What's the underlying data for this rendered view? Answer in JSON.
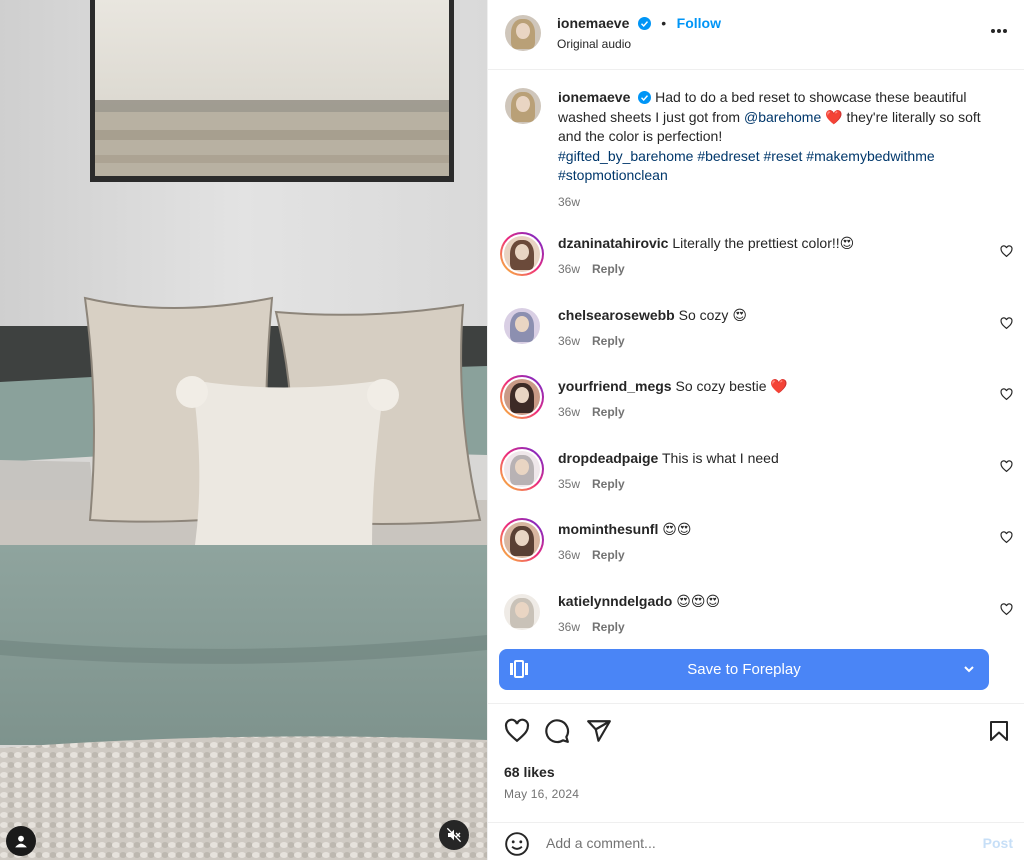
{
  "post": {
    "username": "ionemaeve",
    "separator": "•",
    "follow_label": "Follow",
    "audio_label": "Original audio",
    "more_icon": "more-horizontal-icon"
  },
  "caption": {
    "username": "ionemaeve",
    "text_1": "Had to do a bed reset to showcase these beautiful washed sheets I just got from ",
    "mention": "@barehome",
    "emoji": "❤️",
    "text_2": " they're literally so soft and the color is perfection!",
    "hashtags": "#gifted_by_barehome #bedreset #reset #makemybedwithme #stopmotionclean",
    "time": "36w"
  },
  "comments": [
    {
      "username": "dzaninatahirovic",
      "text": "Literally the prettiest color!!😍",
      "time": "36w",
      "reply_label": "Reply"
    },
    {
      "username": "chelsearosewebb",
      "text": "So cozy 😍",
      "time": "36w",
      "reply_label": "Reply"
    },
    {
      "username": "yourfriend_megs",
      "text": "So cozy bestie ❤️",
      "time": "36w",
      "reply_label": "Reply"
    },
    {
      "username": "dropdeadpaige",
      "text": "This is what I need",
      "time": "35w",
      "reply_label": "Reply"
    },
    {
      "username": "mominthesunfl",
      "text": "😍😍",
      "time": "36w",
      "reply_label": "Reply"
    },
    {
      "username": "katielynndelgado",
      "text": "😍😍😍",
      "time": "36w",
      "reply_label": "Reply"
    }
  ],
  "save_bar": {
    "label": "Save to Foreplay",
    "color": "#4a85f6"
  },
  "stats": {
    "likes": "68 likes",
    "date": "May 16, 2024"
  },
  "compose": {
    "placeholder": "Add a comment...",
    "post_label": "Post"
  },
  "colors": {
    "link": "#0095f6",
    "hashtag": "#00376b",
    "muted": "#737373",
    "verified": "#0095f6"
  }
}
